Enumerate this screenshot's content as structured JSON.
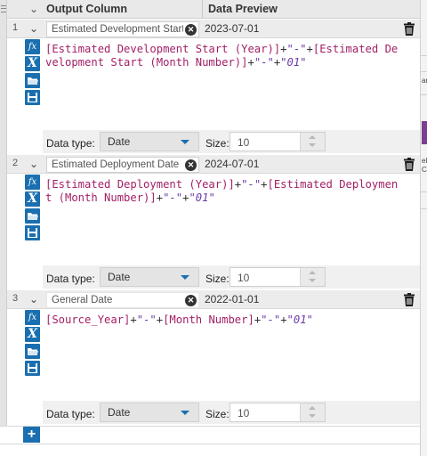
{
  "header": {
    "col_output": "Output Column",
    "col_preview": "Data Preview"
  },
  "rows": [
    {
      "number": "1",
      "name": "Estimated Development Start (Year) formula",
      "name_display": "Estimated Development Start",
      "preview": "2023-07-01",
      "expression_tokens": [
        [
          "f",
          "[Estimated Development Start (Year)]"
        ],
        [
          "o",
          "+"
        ],
        [
          "s",
          "\"-\""
        ],
        [
          "o",
          "+"
        ],
        [
          "f",
          "[Estimated Development Start (Month Number)]"
        ],
        [
          "o",
          "+"
        ],
        [
          "s",
          "\"-\""
        ],
        [
          "o",
          "+"
        ],
        [
          "s",
          "\"01\""
        ]
      ],
      "data_type_label": "Data type:",
      "data_type": "Date",
      "size_label": "Size:",
      "size": "10"
    },
    {
      "number": "2",
      "name_display": "Estimated Deployment Date",
      "preview": "2024-07-01",
      "expression_tokens": [
        [
          "f",
          "[Estimated Deployment (Year)]"
        ],
        [
          "o",
          "+"
        ],
        [
          "s",
          "\"-\""
        ],
        [
          "o",
          "+"
        ],
        [
          "f",
          "[Estimated Deployment (Month Number)]"
        ],
        [
          "o",
          "+"
        ],
        [
          "s",
          "\"-\""
        ],
        [
          "o",
          "+"
        ],
        [
          "s",
          "\"01\""
        ]
      ],
      "data_type_label": "Data type:",
      "data_type": "Date",
      "size_label": "Size:",
      "size": "10"
    },
    {
      "number": "3",
      "name_display": "General Date",
      "preview": "2022-01-01",
      "expression_tokens": [
        [
          "f",
          "[Source_Year]"
        ],
        [
          "o",
          "+"
        ],
        [
          "s",
          "\"-\""
        ],
        [
          "o",
          "+"
        ],
        [
          "f",
          "[Month Number]"
        ],
        [
          "o",
          "+"
        ],
        [
          "s",
          "\"-\""
        ],
        [
          "o",
          "+"
        ],
        [
          "s",
          "\"01\""
        ]
      ],
      "data_type_label": "Data type:",
      "data_type": "Date",
      "size_label": "Size:",
      "size": "10"
    }
  ],
  "tools": {
    "fx": "fx",
    "x": "X"
  },
  "add_button": "+",
  "right_panel": {
    "fragments": [
      "ar",
      "elo",
      "C"
    ]
  },
  "colors": {
    "accent": "#1a6fb0",
    "field": "#a31f66",
    "string": "#6b3aa8",
    "right_panel_highlight": "#7a3f8f"
  }
}
